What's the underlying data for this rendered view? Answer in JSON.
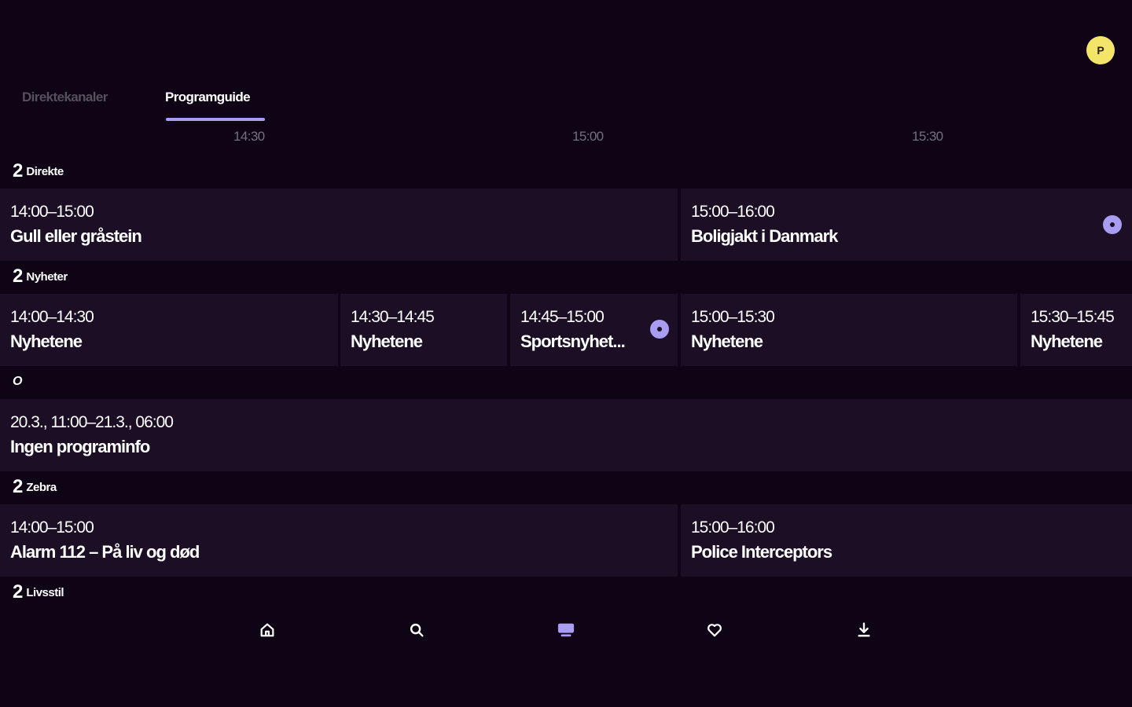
{
  "profile": {
    "initial": "P"
  },
  "tabs": [
    {
      "label": "Direktekanaler",
      "active": false
    },
    {
      "label": "Programguide",
      "active": true
    }
  ],
  "timeline": [
    "14:30",
    "15:00",
    "15:30"
  ],
  "channels": [
    {
      "logo": "2",
      "name": "Direkte",
      "programs": [
        {
          "time": "14:00–15:00",
          "title": "Gull eller gråstein"
        },
        {
          "time": "15:00–16:00",
          "title": "Boligjakt i Danmark",
          "live_indicator": true
        }
      ]
    },
    {
      "logo": "2",
      "name": "Nyheter",
      "programs": [
        {
          "time": "14:00–14:30",
          "title": "Nyhetene"
        },
        {
          "time": "14:30–14:45",
          "title": "Nyhetene"
        },
        {
          "time": "14:45–15:00",
          "title": "Sportsnyhet...",
          "live_indicator": true
        },
        {
          "time": "15:00–15:30",
          "title": "Nyhetene"
        },
        {
          "time": "15:30–15:45",
          "title": "Nyhetene"
        }
      ]
    },
    {
      "logo": "O",
      "name": "",
      "programs": [
        {
          "time": "20.3., 11:00–21.3., 06:00",
          "title": "Ingen programinfo"
        }
      ]
    },
    {
      "logo": "2",
      "name": "Zebra",
      "programs": [
        {
          "time": "14:00–15:00",
          "title": "Alarm 112 – På liv og død"
        },
        {
          "time": "15:00–16:00",
          "title": "Police Interceptors"
        }
      ]
    },
    {
      "logo": "2",
      "name": "Livsstil",
      "programs": []
    }
  ],
  "bottom_nav": [
    {
      "icon": "home-icon",
      "active": false
    },
    {
      "icon": "search-icon",
      "active": false
    },
    {
      "icon": "tv-guide-icon",
      "active": true
    },
    {
      "icon": "heart-icon",
      "active": false
    },
    {
      "icon": "download-icon",
      "active": false
    }
  ],
  "colors": {
    "background": "#0f0416",
    "cell": "#1c0f25",
    "accent": "#a99cf3",
    "avatar": "#f3e56a"
  }
}
